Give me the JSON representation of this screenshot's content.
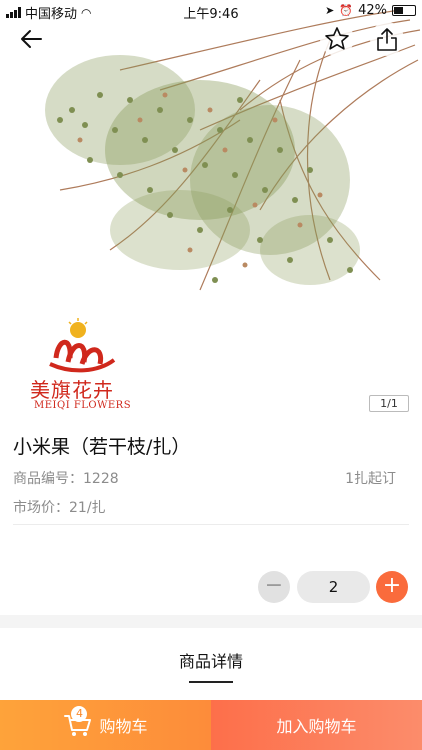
{
  "status_bar": {
    "carrier": "中国移动",
    "time": "上午9:46",
    "battery": "42%"
  },
  "hero": {
    "brand_cn": "美旗花卉",
    "brand_en": "MEIQI FLOWERS",
    "pager": "1/1"
  },
  "nav": {
    "back_icon": "back-arrow-icon",
    "favorite_icon": "star-icon",
    "share_icon": "share-icon"
  },
  "product": {
    "title": "小米果（若干枝/扎）",
    "sku_label": "商品编号：",
    "sku_value": "1228",
    "min_order": "1扎起订",
    "price_label": "市场价：",
    "price_value": "21/扎"
  },
  "quantity": {
    "minus": "−",
    "value": "2",
    "plus": "+"
  },
  "details": {
    "tab_label": "商品详情"
  },
  "bottom_bar": {
    "cart_count": "4",
    "cart_label": "购物车",
    "add_to_cart_label": "加入购物车"
  },
  "colors": {
    "accent": "#fa6b3c",
    "cart_gradient_start": "#fea33a",
    "add_gradient_start": "#fd6f4a",
    "brand_red": "#d0281c"
  }
}
